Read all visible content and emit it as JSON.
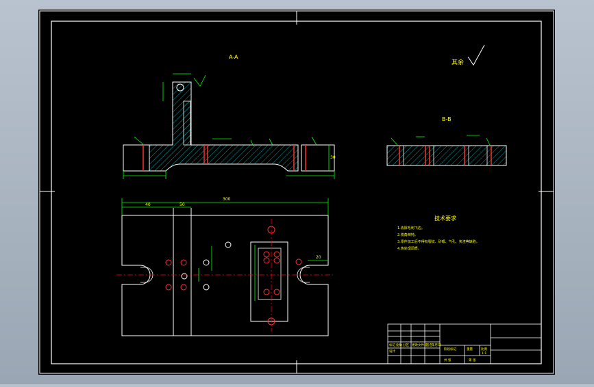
{
  "colors": {
    "window_bg": "#a9b4c0",
    "paper": "#000000",
    "outline": "#ffffff",
    "dimension": "#00ff00",
    "hatch": "#00a0a0",
    "section_line": "#ff3030",
    "center_line": "#ff0000",
    "annotation": "#ffff00"
  },
  "views": {
    "section_aa_label": "A-A",
    "section_bb_label": "B-B",
    "surface_finish_note": "其余"
  },
  "dimensions": {
    "overall_length": "300",
    "left_offset": "40",
    "second_offset": "50",
    "height": "30",
    "slot_width": "20"
  },
  "technical_requirements": {
    "title": "技术要求",
    "lines": [
      "1.去除毛刺飞边。",
      "2.锐角倒钝。",
      "3.零件加工后不得有裂纹、砂眼、气孔、夹渣等缺陷。",
      "4.热处理调质。"
    ]
  },
  "title_block": {
    "row_labels": [
      "标记",
      "处数",
      "分区",
      "更改文件号",
      "签名",
      "年月日"
    ],
    "design_label": "设计",
    "stage_label": "阶段标记",
    "weight_label": "重量",
    "scale_label": "比例",
    "scale_value": "1:1",
    "sheet_label": "共 张",
    "sheet_of": "第 张"
  }
}
